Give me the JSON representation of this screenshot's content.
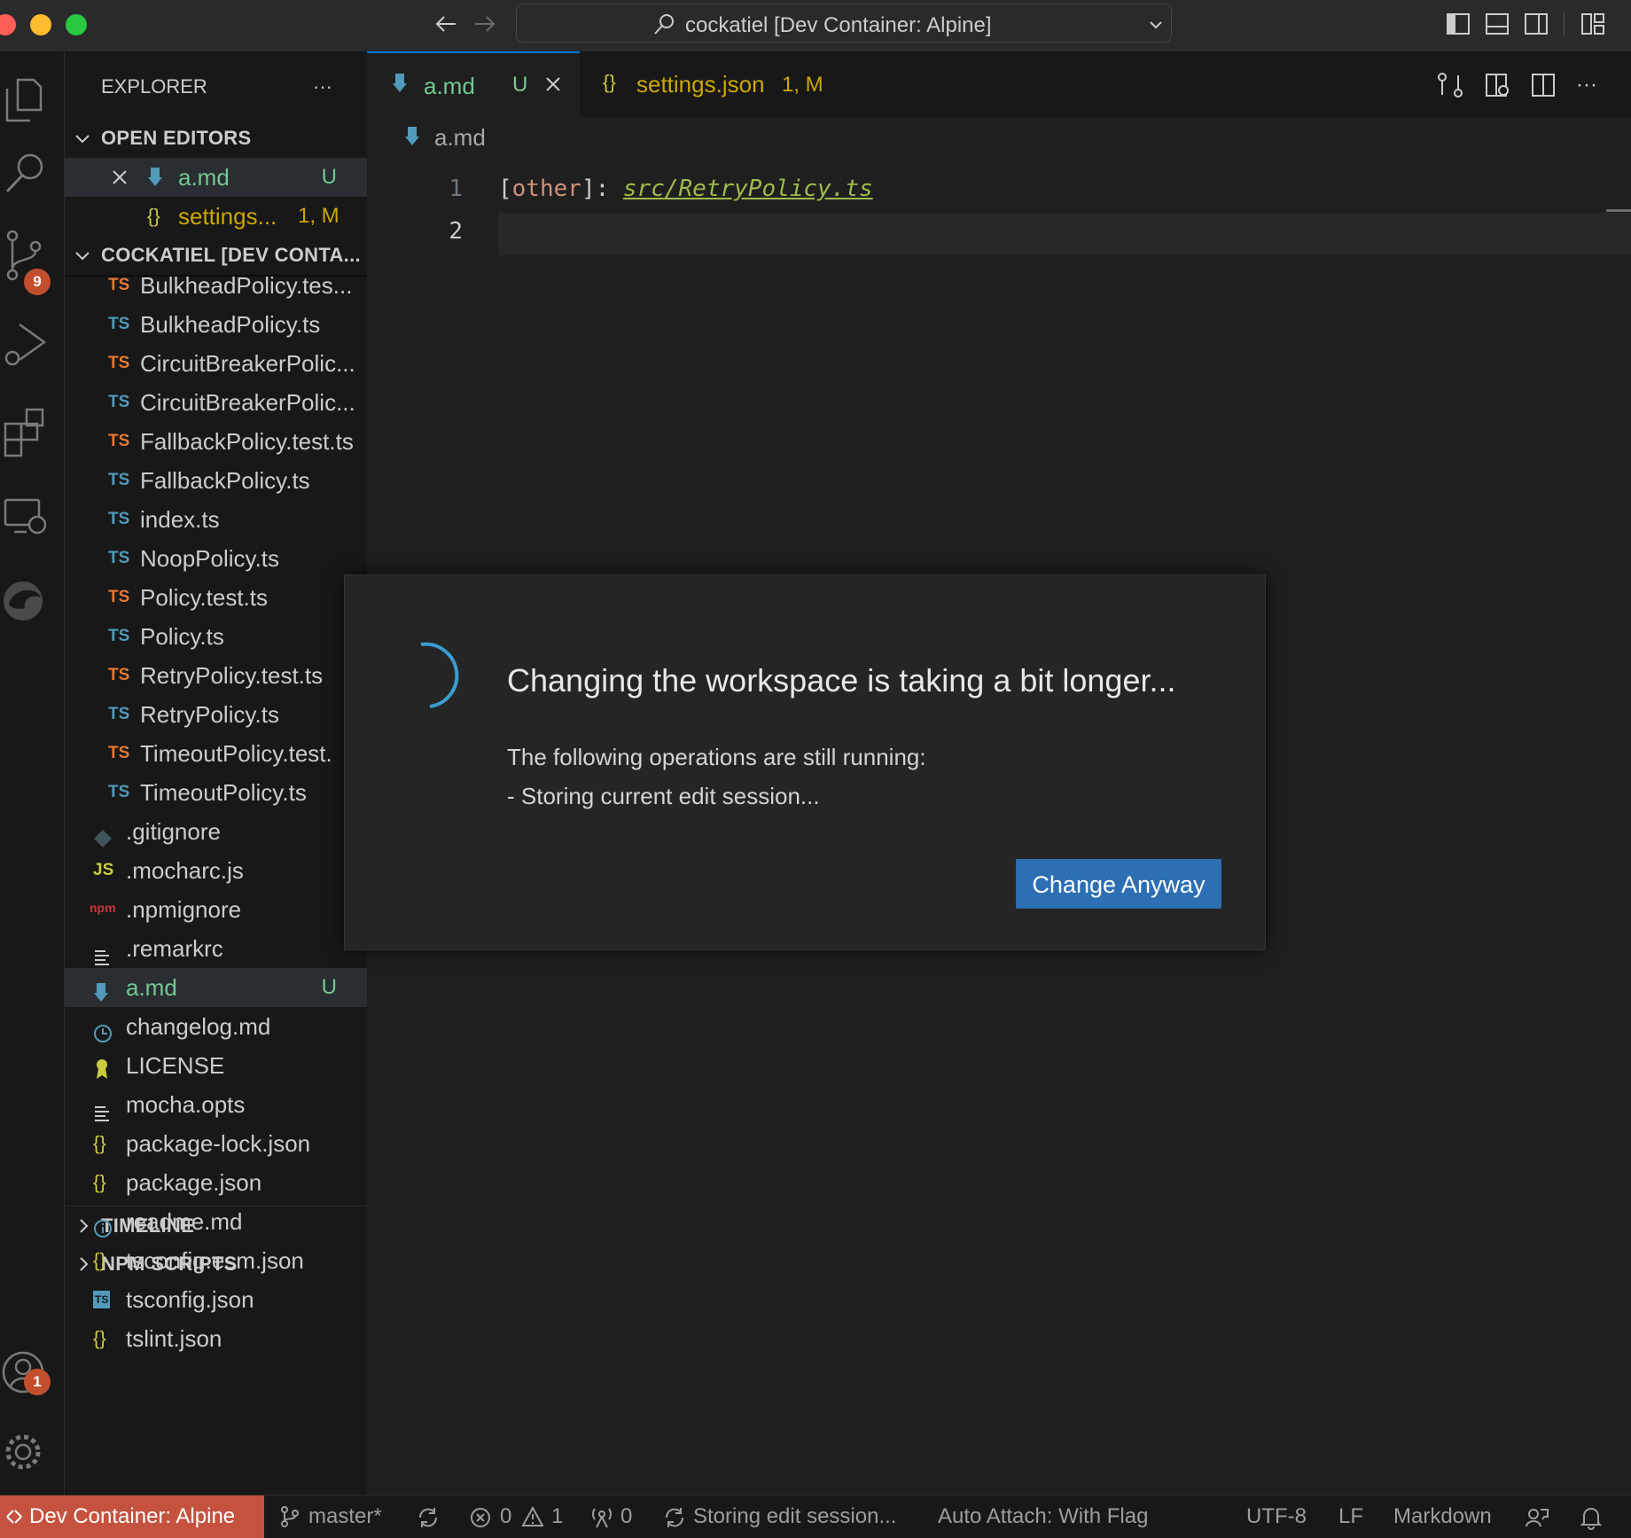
{
  "window": {
    "title": "cockatiel [Dev Container: Alpine]"
  },
  "colors": {
    "accent": "#0078d4",
    "button": "#2d6fb3",
    "remote_indicator": "#c5523f",
    "git_untracked": "#73c991",
    "modified": "#cca700",
    "badge": "#c24e2e"
  },
  "activity_bar": {
    "scm_badge": "9",
    "accounts_badge": "1"
  },
  "sidebar": {
    "title": "EXPLORER",
    "more": "···",
    "open_editors": {
      "header": "OPEN EDITORS",
      "items": [
        {
          "name": "a.md",
          "status": "U"
        },
        {
          "name": "settings...",
          "status": "1, M"
        }
      ]
    },
    "folder": {
      "header": "COCKATIEL [DEV CONTA...",
      "items": [
        {
          "name": "BulkheadPolicy.tes...",
          "icon": "TS",
          "test": true
        },
        {
          "name": "BulkheadPolicy.ts",
          "icon": "TS",
          "test": false
        },
        {
          "name": "CircuitBreakerPolic...",
          "icon": "TS",
          "test": true
        },
        {
          "name": "CircuitBreakerPolic...",
          "icon": "TS",
          "test": false
        },
        {
          "name": "FallbackPolicy.test.ts",
          "icon": "TS",
          "test": true
        },
        {
          "name": "FallbackPolicy.ts",
          "icon": "TS",
          "test": false
        },
        {
          "name": "index.ts",
          "icon": "TS",
          "test": false
        },
        {
          "name": "NoopPolicy.ts",
          "icon": "TS",
          "test": false
        },
        {
          "name": "Policy.test.ts",
          "icon": "TS",
          "test": true
        },
        {
          "name": "Policy.ts",
          "icon": "TS",
          "test": false
        },
        {
          "name": "RetryPolicy.test.ts",
          "icon": "TS",
          "test": true
        },
        {
          "name": "RetryPolicy.ts",
          "icon": "TS",
          "test": false
        },
        {
          "name": "TimeoutPolicy.test.",
          "icon": "TS",
          "test": true
        },
        {
          "name": "TimeoutPolicy.ts",
          "icon": "TS",
          "test": false
        }
      ],
      "root_items": [
        {
          "name": ".gitignore",
          "icon": "git-icon"
        },
        {
          "name": ".mocharc.js",
          "icon": "js-icon",
          "icon_text": "JS"
        },
        {
          "name": ".npmignore",
          "icon": "npm-icon",
          "icon_text": "npm"
        },
        {
          "name": ".remarkrc",
          "icon": "lines-icon"
        },
        {
          "name": "a.md",
          "icon": "markdown-icon",
          "status": "U"
        },
        {
          "name": "changelog.md",
          "icon": "clock-icon"
        },
        {
          "name": "LICENSE",
          "icon": "license-icon"
        },
        {
          "name": "mocha.opts",
          "icon": "lines-icon"
        },
        {
          "name": "package-lock.json",
          "icon": "json-icon"
        },
        {
          "name": "package.json",
          "icon": "json-icon"
        },
        {
          "name": "readme.md",
          "icon": "info-icon"
        },
        {
          "name": "tsconfig.esm.json",
          "icon": "json-icon"
        },
        {
          "name": "tsconfig.json",
          "icon": "tsconfig-icon",
          "icon_text": "TS"
        },
        {
          "name": "tslint.json",
          "icon": "json-icon"
        }
      ]
    },
    "timeline": "TIMELINE",
    "npm_scripts": "NPM SCRIPTS"
  },
  "editor": {
    "tabs": [
      {
        "name": "a.md",
        "status": "U"
      },
      {
        "name": "settings.json",
        "status": "1, M"
      }
    ],
    "breadcrumb": "a.md",
    "lines": [
      {
        "number": "1",
        "bracket_open": "[",
        "ref": "other",
        "bracket_close": "]:",
        "link": "src/RetryPolicy.ts"
      },
      {
        "number": "2"
      }
    ]
  },
  "dialog": {
    "title": "Changing the workspace is taking a bit longer...",
    "line1": "The following operations are still running:",
    "line2": "- Storing current edit session...",
    "button": "Change Anyway"
  },
  "status_bar": {
    "remote": "Dev Container: Alpine",
    "branch": "master*",
    "errors": "0",
    "warnings": "1",
    "ports": "0",
    "sync_message": "Storing edit session...",
    "auto_attach": "Auto Attach: With Flag",
    "encoding": "UTF-8",
    "eol": "LF",
    "language": "Markdown"
  }
}
